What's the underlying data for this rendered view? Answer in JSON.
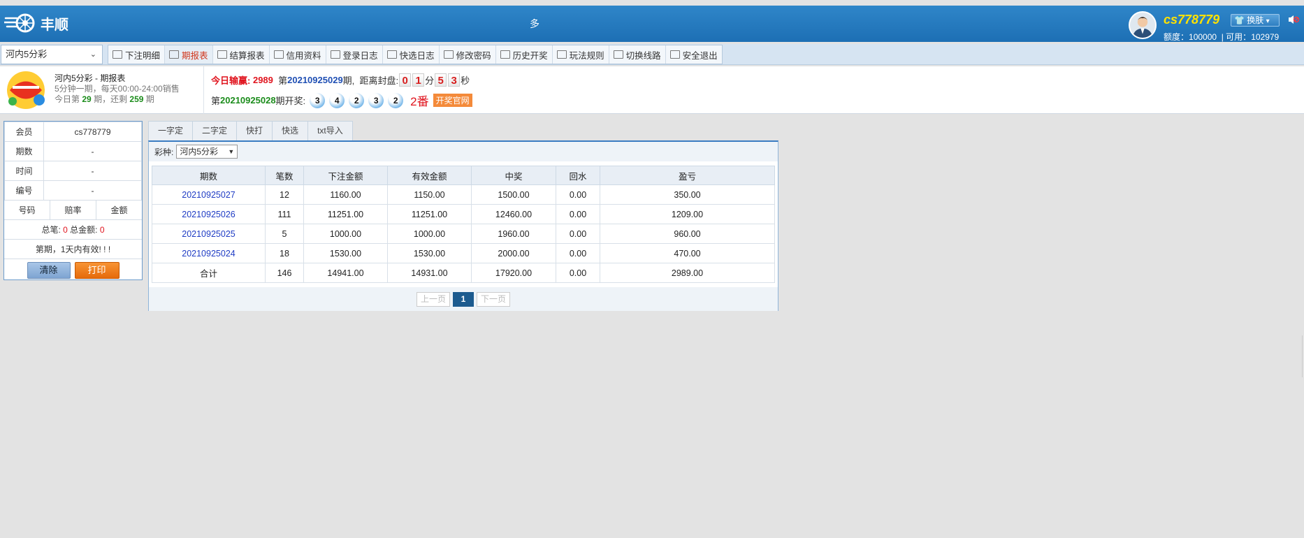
{
  "header": {
    "brand": "丰顺",
    "center_text": "多",
    "user": {
      "name": "cs778779",
      "skin_label": "换肤",
      "quota_label": "额度：",
      "quota_value": "100000",
      "available_label": "| 可用：",
      "available_value": "102979"
    }
  },
  "nav": {
    "game_select": "河内5分彩",
    "menu": [
      {
        "label": "下注明细",
        "icon": "list-icon"
      },
      {
        "label": "期报表",
        "icon": "bar-chart-icon",
        "active": true
      },
      {
        "label": "结算报表",
        "icon": "bar-chart-icon"
      },
      {
        "label": "信用资料",
        "icon": "id-card-icon"
      },
      {
        "label": "登录日志",
        "icon": "monitor-icon"
      },
      {
        "label": "快选日志",
        "icon": "monitor-icon"
      },
      {
        "label": "修改密码",
        "icon": "lock-icon"
      },
      {
        "label": "历史开奖",
        "icon": "ball-icon"
      },
      {
        "label": "玩法规则",
        "icon": "layers-icon"
      },
      {
        "label": "切换线路",
        "icon": "wifi-icon"
      },
      {
        "label": "安全退出",
        "icon": "monitor-icon"
      }
    ]
  },
  "info": {
    "game_title": "河内5分彩 - 期报表",
    "schedule": "5分钟一期，每天00:00-24:00销售",
    "today_prefix": "今日第",
    "today_period": "29",
    "today_mid": "期，还剩",
    "remaining": "259",
    "today_suffix": "期",
    "profit_label": "今日输赢:",
    "profit_value": "2989",
    "cur_prefix": "第",
    "cur_period": "20210925029",
    "cur_suffix": "期,",
    "close_label": "距离封盘:",
    "countdown": {
      "m1": "0",
      "m2": "1",
      "min_label": "分",
      "s1": "5",
      "s2": "3",
      "sec_label": "秒"
    },
    "last_prefix": "第",
    "last_period": "20210925028",
    "last_suffix": "期开奖:",
    "balls": [
      "3",
      "4",
      "2",
      "3",
      "2"
    ],
    "fan": "2番",
    "official_label": "开奖官网"
  },
  "left": {
    "member_label": "会员",
    "member_value": "cs778779",
    "period_label": "期数",
    "period_value": "-",
    "time_label": "时间",
    "time_value": "-",
    "code_label": "编号",
    "code_value": "-",
    "cols": [
      "号码",
      "赔率",
      "金额"
    ],
    "total_count_label": "总笔:",
    "total_count": "0",
    "total_amount_label": "总金额:",
    "total_amount": "0",
    "note": "第期，1天内有效! ! !",
    "clear_label": "清除",
    "print_label": "打印"
  },
  "main": {
    "tabs": [
      "一字定",
      "二字定",
      "快打",
      "快选",
      "txt导入"
    ],
    "filter_label": "彩种:",
    "filter_value": "河内5分彩",
    "headers": [
      "期数",
      "笔数",
      "下注金额",
      "有效金额",
      "中奖",
      "回水",
      "盈亏"
    ],
    "rows": [
      {
        "period": "20210925027",
        "count": "12",
        "bet": "1160.00",
        "valid": "1150.00",
        "win": "1500.00",
        "rebate": "0.00",
        "profit": "350.00"
      },
      {
        "period": "20210925026",
        "count": "111",
        "bet": "11251.00",
        "valid": "11251.00",
        "win": "12460.00",
        "rebate": "0.00",
        "profit": "1209.00"
      },
      {
        "period": "20210925025",
        "count": "5",
        "bet": "1000.00",
        "valid": "1000.00",
        "win": "1960.00",
        "rebate": "0.00",
        "profit": "960.00"
      },
      {
        "period": "20210925024",
        "count": "18",
        "bet": "1530.00",
        "valid": "1530.00",
        "win": "2000.00",
        "rebate": "0.00",
        "profit": "470.00"
      }
    ],
    "total": {
      "label": "合计",
      "count": "146",
      "bet": "14941.00",
      "valid": "14931.00",
      "win": "17920.00",
      "rebate": "0.00",
      "profit": "2989.00"
    },
    "pager": {
      "prev": "上一页",
      "current": "1",
      "next": "下一页"
    }
  },
  "colors": {
    "header_blue": "#2f86c9",
    "accent_red": "#e0141e",
    "link_blue": "#1f3cc4",
    "print_orange": "#f07a16"
  }
}
